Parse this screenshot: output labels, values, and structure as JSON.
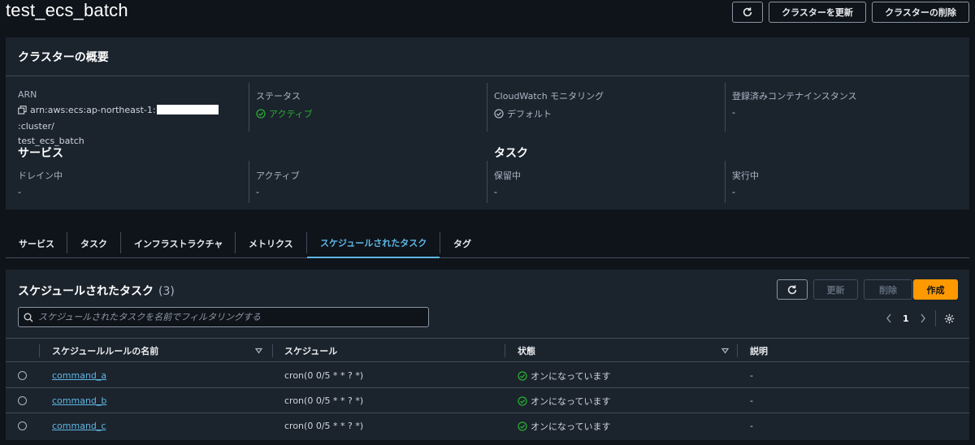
{
  "header": {
    "title": "test_ecs_batch",
    "update_cluster": "クラスターを更新",
    "delete_cluster": "クラスターの削除"
  },
  "overview": {
    "title": "クラスターの概要",
    "arn_label": "ARN",
    "arn_prefix": "arn:aws:ecs:ap-northeast-1:",
    "arn_suffix": ":cluster/",
    "arn_name": "test_ecs_batch",
    "status_label": "ステータス",
    "status_value": "アクティブ",
    "cloudwatch_label": "CloudWatch モニタリング",
    "cloudwatch_value": "デフォルト",
    "instances_label": "登録済みコンテナインスタンス",
    "instances_value": "-",
    "services_heading": "サービス",
    "draining_label": "ドレイン中",
    "draining_value": "-",
    "active_label": "アクティブ",
    "active_value": "-",
    "tasks_heading": "タスク",
    "pending_label": "保留中",
    "pending_value": "-",
    "running_label": "実行中",
    "running_value": "-"
  },
  "tabs": [
    {
      "label": "サービス"
    },
    {
      "label": "タスク"
    },
    {
      "label": "インフラストラクチャ"
    },
    {
      "label": "メトリクス"
    },
    {
      "label": "スケジュールされたタスク"
    },
    {
      "label": "タグ"
    }
  ],
  "scheduled": {
    "title": "スケジュールされたタスク",
    "count": "(3)",
    "update": "更新",
    "delete": "削除",
    "create": "作成",
    "search_placeholder": "スケジュールされたタスクを名前でフィルタリングする",
    "page": "1",
    "columns": {
      "name": "スケジュールルールの名前",
      "schedule": "スケジュール",
      "state": "状態",
      "description": "説明"
    },
    "rows": [
      {
        "name": "command_a",
        "schedule": "cron(0 0/5 * * ? *)",
        "state": "オンになっています",
        "description": "-"
      },
      {
        "name": "command_b",
        "schedule": "cron(0 0/5 * * ? *)",
        "state": "オンになっています",
        "description": "-"
      },
      {
        "name": "command_c",
        "schedule": "cron(0 0/5 * * ? *)",
        "state": "オンになっています",
        "description": "-"
      }
    ]
  },
  "colors": {
    "accent_link": "#5fb7e4",
    "status_green": "#29ad32",
    "primary_orange": "#ff9900"
  }
}
